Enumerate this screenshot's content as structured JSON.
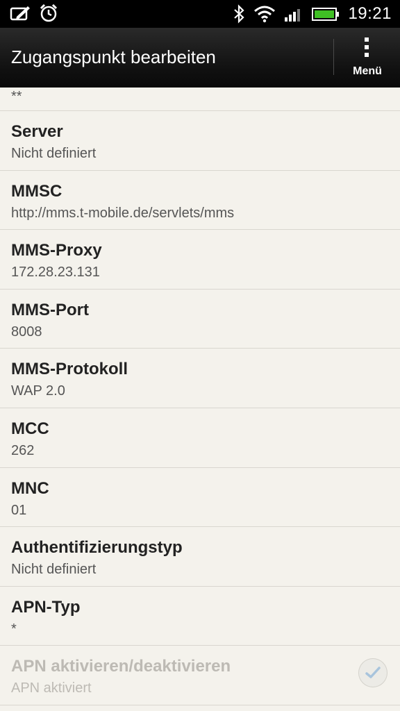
{
  "status_bar": {
    "time": "19:21",
    "icons": [
      "edit-note-icon",
      "alarm-clock-icon",
      "bluetooth-icon",
      "wifi-icon",
      "signal-icon",
      "battery-icon"
    ],
    "battery_color": "#3fbf24"
  },
  "action_bar": {
    "title": "Zugangspunkt bearbeiten",
    "menu_label": "Menü"
  },
  "list": {
    "partial_value": "**",
    "items": [
      {
        "label": "Server",
        "value": "Nicht definiert"
      },
      {
        "label": "MMSC",
        "value": "http://mms.t-mobile.de/servlets/mms"
      },
      {
        "label": "MMS-Proxy",
        "value": "172.28.23.131"
      },
      {
        "label": "MMS-Port",
        "value": "8008"
      },
      {
        "label": "MMS-Protokoll",
        "value": "WAP 2.0"
      },
      {
        "label": "MCC",
        "value": "262"
      },
      {
        "label": "MNC",
        "value": "01"
      },
      {
        "label": "Authentifizierungstyp",
        "value": "Nicht definiert"
      },
      {
        "label": "APN-Typ",
        "value": "*"
      },
      {
        "label": "APN aktivieren/deaktivieren",
        "value": "APN aktiviert",
        "checked": true,
        "enabled": false
      }
    ]
  }
}
